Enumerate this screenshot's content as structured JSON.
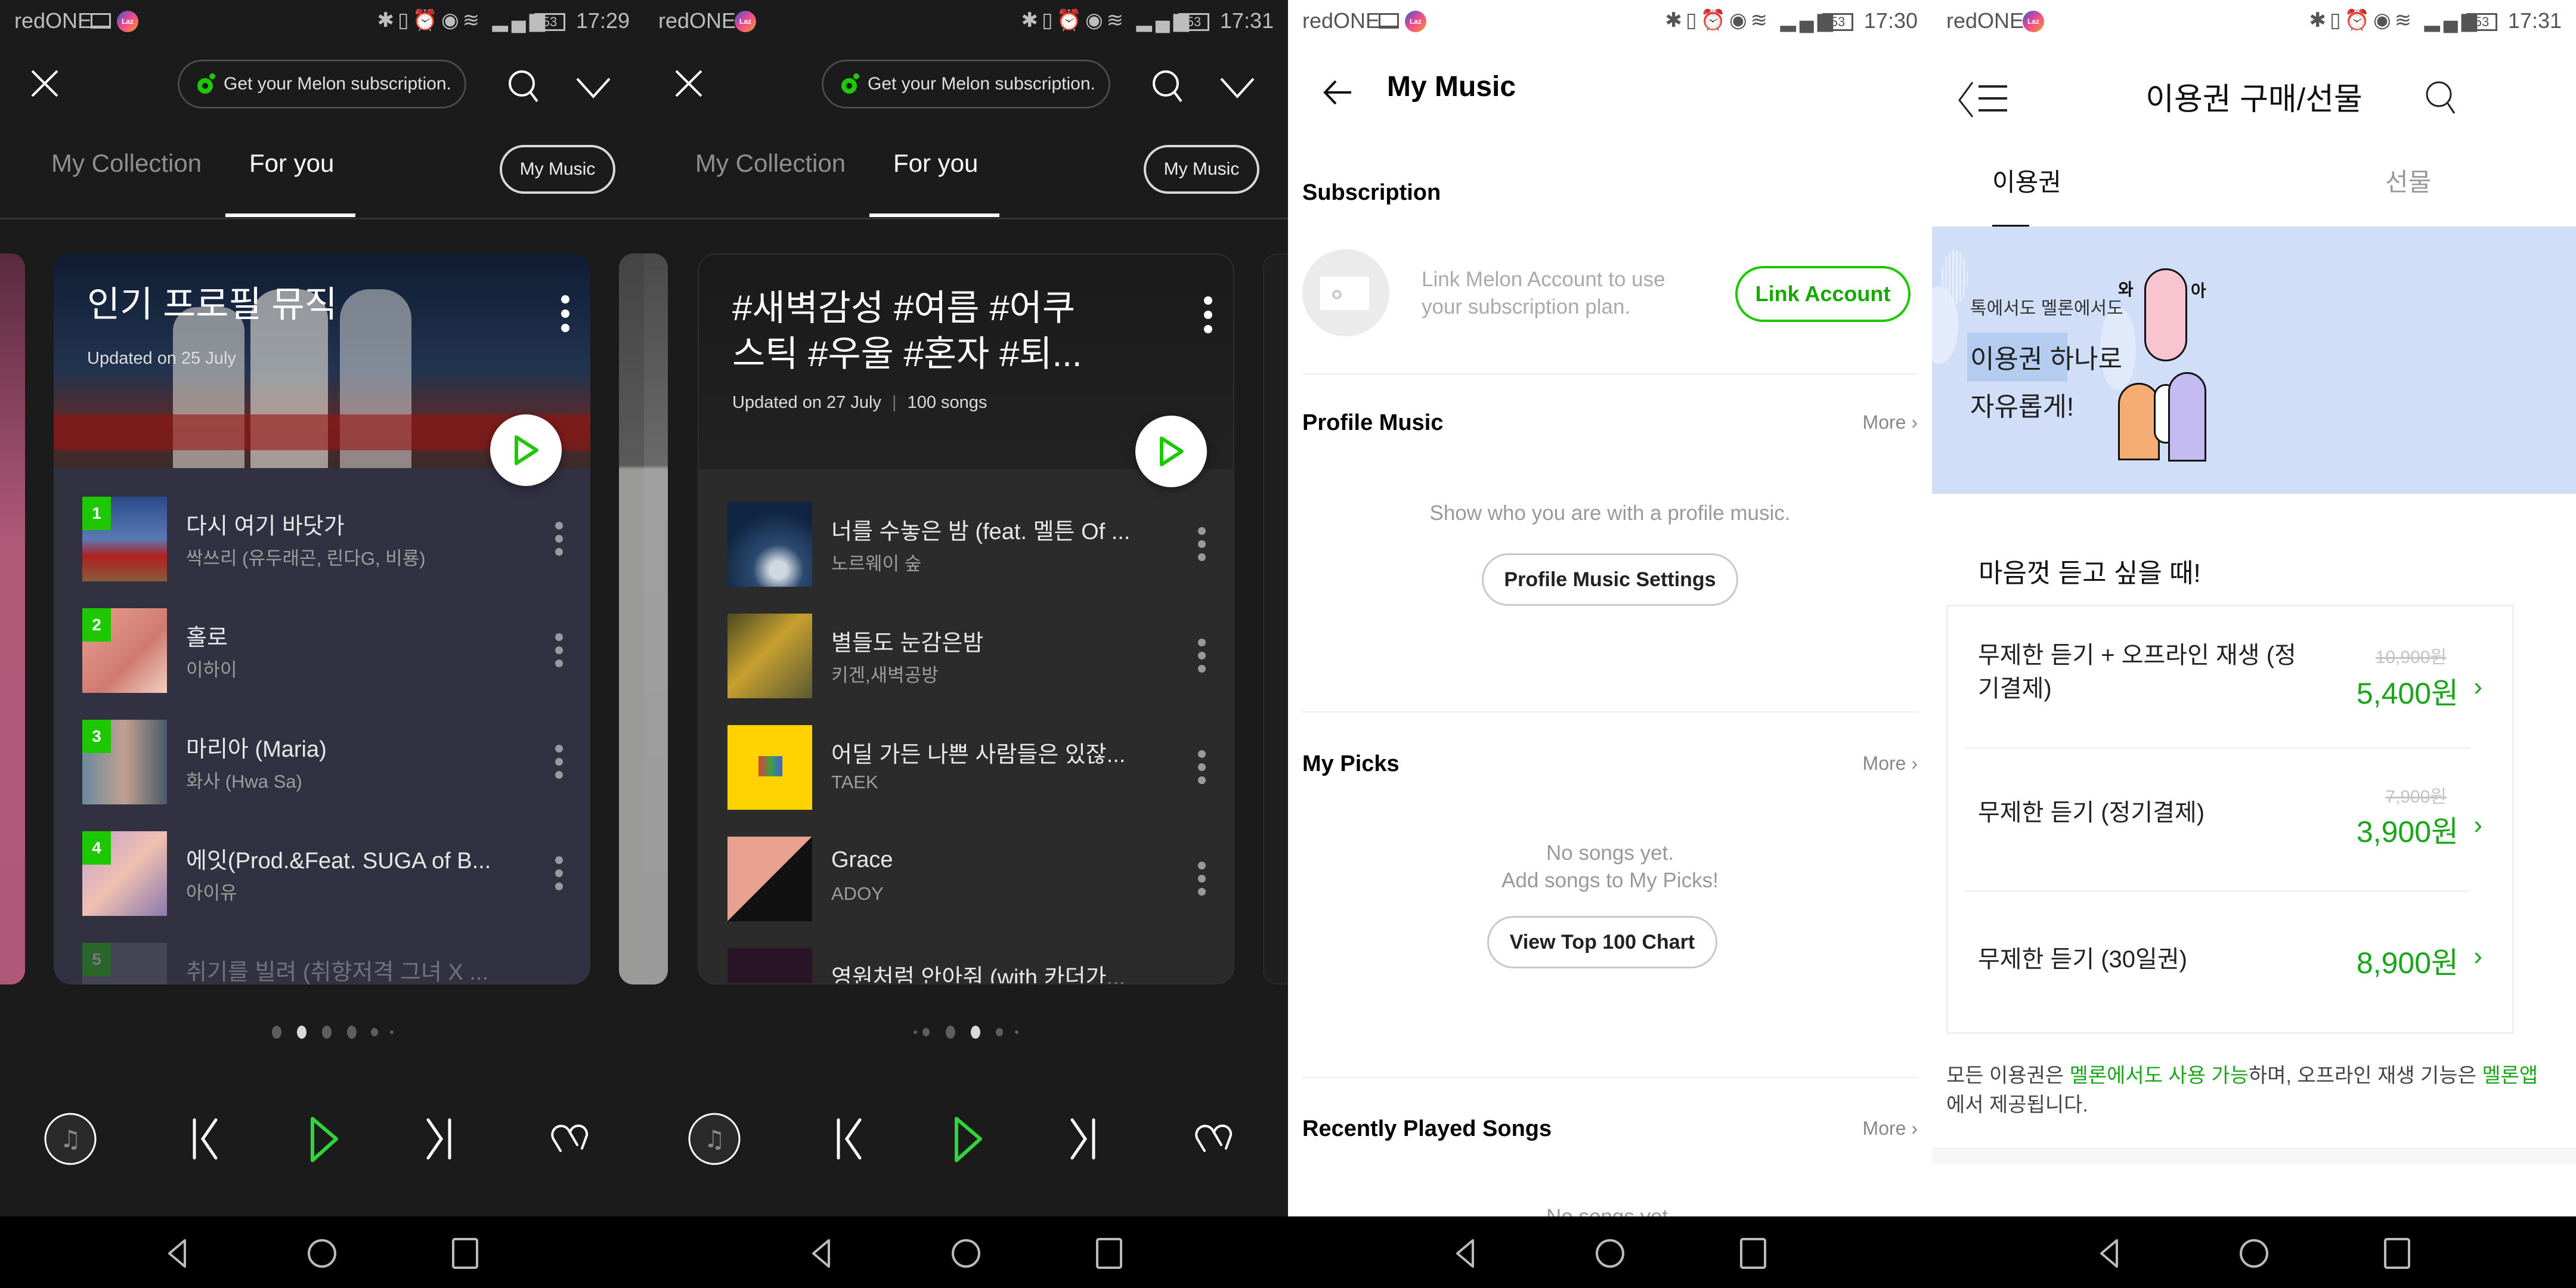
{
  "colors": {
    "accent": "#1ec800",
    "price_green": "#1ba51b",
    "dark_bg": "#1b1b1b",
    "card1_list_bg": "#313142",
    "card2_list_bg": "#2b2b2b",
    "banner_bg": "#d0dff7"
  },
  "panels": [
    {
      "status": {
        "carrier": "redONE",
        "badge": "Laz",
        "battery": "53",
        "time": "17:29"
      },
      "topbar": {
        "subscription_label": "Get your Melon subscription."
      },
      "tabs": [
        {
          "label": "My Collection",
          "active": false
        },
        {
          "label": "For you",
          "active": true
        }
      ],
      "my_music_label": "My Music",
      "card": {
        "title": "인기 프로필 뮤직",
        "subtitle": "Updated on 25 July",
        "songs": [
          {
            "rank": "1",
            "title": "다시 여기 바닷가",
            "artist": "싹쓰리 (유두래곤, 린다G, 비룡)"
          },
          {
            "rank": "2",
            "title": "홀로",
            "artist": "이하이"
          },
          {
            "rank": "3",
            "title": "마리아 (Maria)",
            "artist": "화사 (Hwa Sa)"
          },
          {
            "rank": "4",
            "title": "에잇(Prod.&Feat. SUGA of B...",
            "artist": "아이유"
          },
          {
            "rank": "5",
            "title": "취기를 빌려 (취향저격 그녀 X ...",
            "artist": ""
          }
        ]
      },
      "pager": {
        "count": 6,
        "active_index": 1
      }
    },
    {
      "status": {
        "carrier": "redONE",
        "badge": "Laz",
        "battery": "53",
        "time": "17:31"
      },
      "topbar": {
        "subscription_label": "Get your Melon subscription."
      },
      "tabs": [
        {
          "label": "My Collection",
          "active": false
        },
        {
          "label": "For you",
          "active": true
        }
      ],
      "my_music_label": "My Music",
      "card": {
        "title": "#새벽감성 #여름 #어쿠스틱 #우울 #혼자 #퇴...",
        "subtitle": "Updated on 27 July",
        "song_count": "100 songs",
        "songs": [
          {
            "title": "너를 수놓은 밤 (feat. 멜튼 Of ...",
            "artist": "노르웨이 숲"
          },
          {
            "title": "별들도 눈감은밤",
            "artist": "키겐,새벽공방"
          },
          {
            "title": "어딜 가든 나쁜 사람들은 있잖...",
            "artist": "TAEK"
          },
          {
            "title": "Grace",
            "artist": "ADOY"
          },
          {
            "title": "영원처럼 안아줘 (with 카더가...",
            "artist": ""
          }
        ]
      },
      "pager": {
        "count": 6,
        "active_index": 3
      }
    },
    {
      "status": {
        "carrier": "redONE",
        "badge": "Laz",
        "battery": "53",
        "time": "17:30"
      },
      "title": "My Music",
      "subscription": {
        "heading": "Subscription",
        "text": "Link Melon Account to use your subscription plan.",
        "button": "Link Account"
      },
      "profile_music": {
        "heading": "Profile Music",
        "more": "More",
        "text": "Show who you are with a profile music.",
        "button": "Profile Music Settings"
      },
      "my_picks": {
        "heading": "My Picks",
        "more": "More",
        "text_line1": "No songs yet.",
        "text_line2": "Add songs to My Picks!",
        "button": "View Top 100 Chart"
      },
      "recent": {
        "heading": "Recently Played Songs",
        "more": "More",
        "text": "No songs yet."
      }
    },
    {
      "status": {
        "carrier": "redONE",
        "badge": "Laz",
        "battery": "53",
        "time": "17:31"
      },
      "title": "이용권 구매/선물",
      "tabs": [
        {
          "label": "이용권",
          "active": true
        },
        {
          "label": "선물",
          "active": false
        }
      ],
      "banner": {
        "line1": "톡에서도 멜론에서도",
        "line2": "이용권 하나로",
        "line3": "자유롭게!",
        "sticker_left": "와",
        "sticker_right": "아"
      },
      "plans_heading": "마음껏 듣고 싶을 때!",
      "plans": [
        {
          "name": "무제한 듣기 + 오프라인 재생 (정기결제)",
          "original_price": "10,900원",
          "price": "5,400원"
        },
        {
          "name": "무제한 듣기 (정기결제)",
          "original_price": "7,900원",
          "price": "3,900원"
        },
        {
          "name": "무제한 듣기 (30일권)",
          "original_price": "",
          "price": "8,900원"
        }
      ],
      "notice": {
        "p1": "모든 이용권은 ",
        "g1": "멜론에서도 사용 가능",
        "p2": "하며, 오프라인 재생 기능은 ",
        "g2": "멜론앱",
        "p3": " 에서 제공됩니다."
      }
    }
  ]
}
